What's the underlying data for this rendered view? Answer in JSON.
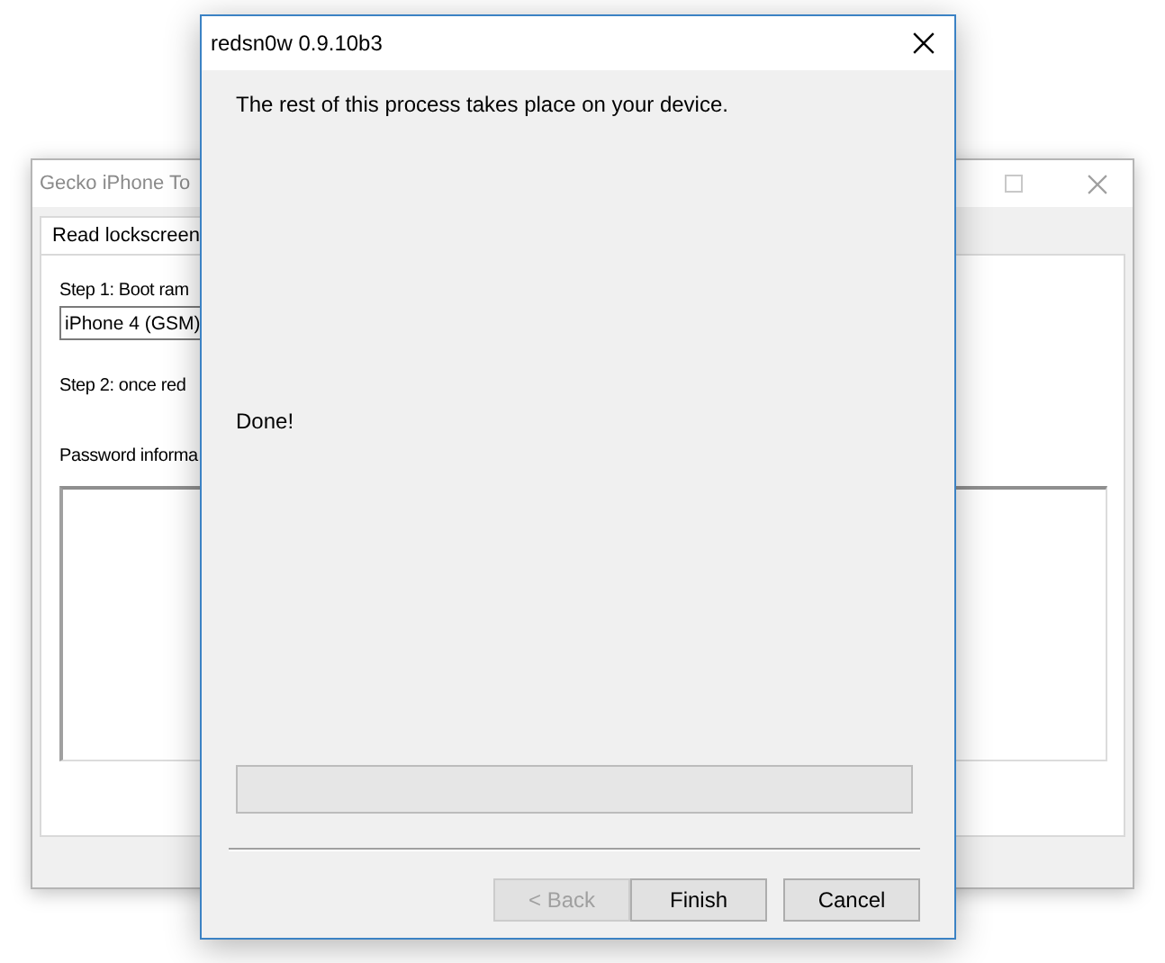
{
  "back_window": {
    "title": "Gecko iPhone To",
    "tab": {
      "label": "Read lockscreen",
      "selected": true
    },
    "step1_label": "Step 1: Boot ram",
    "device_select": {
      "value": "iPhone 4 (GSM)"
    },
    "step2_label": "Step 2: once red",
    "password_label": "Password informa"
  },
  "front_window": {
    "title": "redsn0w 0.9.10b3",
    "message": "The rest of this process takes place on your device.",
    "status": "Done!",
    "progress": {
      "level": 0
    },
    "buttons": [
      {
        "label": "< Back",
        "disabled": true
      },
      {
        "label": "Finish",
        "disabled": false
      },
      {
        "label": "Cancel",
        "disabled": false
      }
    ]
  }
}
